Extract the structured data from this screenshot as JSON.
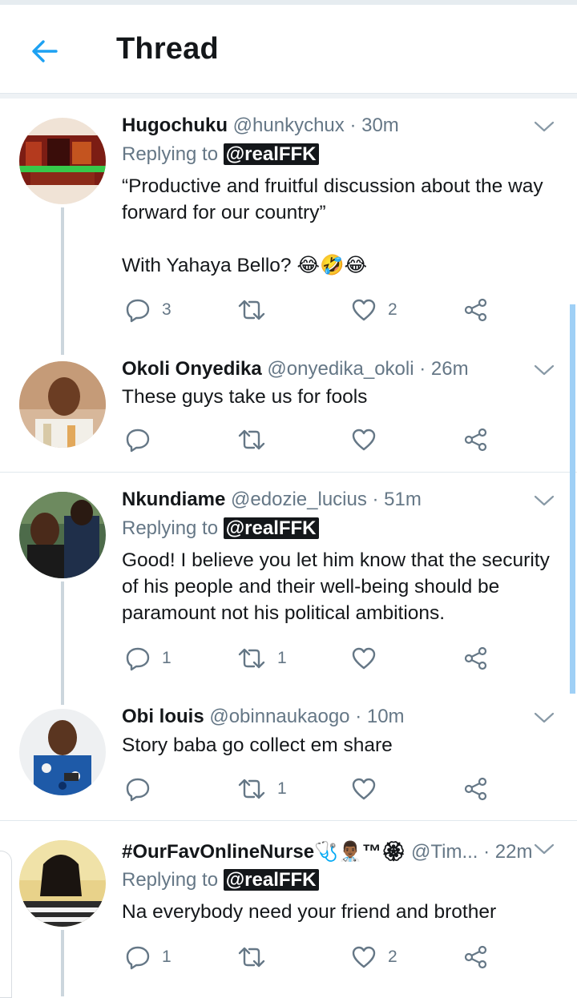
{
  "header": {
    "title": "Thread",
    "back_icon": "arrow-left-icon",
    "accent": "#1da1f2"
  },
  "tweets": [
    {
      "name": "Hugochuku",
      "handle": "@hunkychux",
      "time": "· 30m",
      "reply_prefix": "Replying to",
      "reply_to": "@realFFK",
      "text": "“Productive and fruitful discussion about the way forward for our country”\n\nWith Yahaya Bello? 😂🤣😂",
      "replies": "3",
      "retweets": "",
      "likes": "2"
    },
    {
      "name": "Okoli Onyedika",
      "handle": "@onyedika_okoli",
      "time": "· 26m",
      "text": "These guys take us for fools",
      "replies": "",
      "retweets": "",
      "likes": ""
    },
    {
      "name": "Nkundiame",
      "handle": "@edozie_lucius",
      "time": "· 51m",
      "reply_prefix": "Replying to",
      "reply_to": "@realFFK",
      "text": "Good! I believe you let him know that the security of his people and their well-being should be paramount not his political ambitions.",
      "replies": "1",
      "retweets": "1",
      "likes": ""
    },
    {
      "name": "Obi louis",
      "handle": "@obinnaukaogo",
      "time": "· 10m",
      "text": "Story baba go collect em share",
      "replies": "",
      "retweets": "1",
      "likes": ""
    },
    {
      "name": "#OurFavOnlineNurse🩺👨🏾‍⚕️™🏵",
      "handle": "@Tim...",
      "time": "· 22m",
      "reply_prefix": "Replying to",
      "reply_to": "@realFFK",
      "text": "Na everybody need your friend and brother",
      "replies": "1",
      "retweets": "",
      "likes": "2"
    }
  ]
}
